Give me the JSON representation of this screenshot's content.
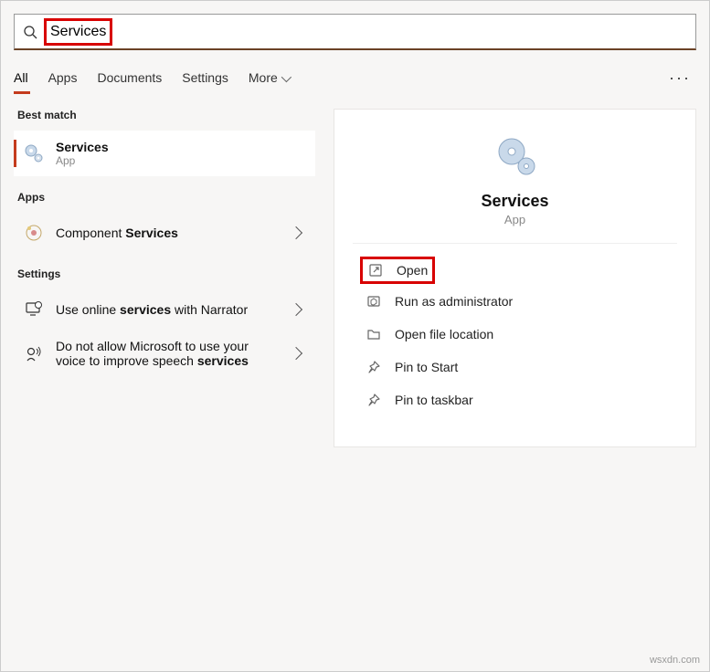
{
  "search": {
    "value": "Services"
  },
  "tabs": {
    "all": "All",
    "apps": "Apps",
    "documents": "Documents",
    "settings": "Settings",
    "more": "More"
  },
  "sections": {
    "best_match": "Best match",
    "apps": "Apps",
    "settings": "Settings"
  },
  "results": {
    "best": {
      "title": "Services",
      "sub": "App"
    },
    "app1": {
      "prefix": "Component ",
      "bold": "Services"
    },
    "setting1": {
      "prefix": "Use online ",
      "bold": "services",
      "suffix": " with Narrator"
    },
    "setting2": {
      "line1_prefix": "Do not allow Microsoft to use your",
      "line2_prefix": "voice to improve speech ",
      "line2_bold": "services"
    }
  },
  "preview": {
    "title": "Services",
    "sub": "App",
    "actions": {
      "open": "Open",
      "admin": "Run as administrator",
      "location": "Open file location",
      "pin_start": "Pin to Start",
      "pin_taskbar": "Pin to taskbar"
    }
  },
  "watermark": "wsxdn.com"
}
